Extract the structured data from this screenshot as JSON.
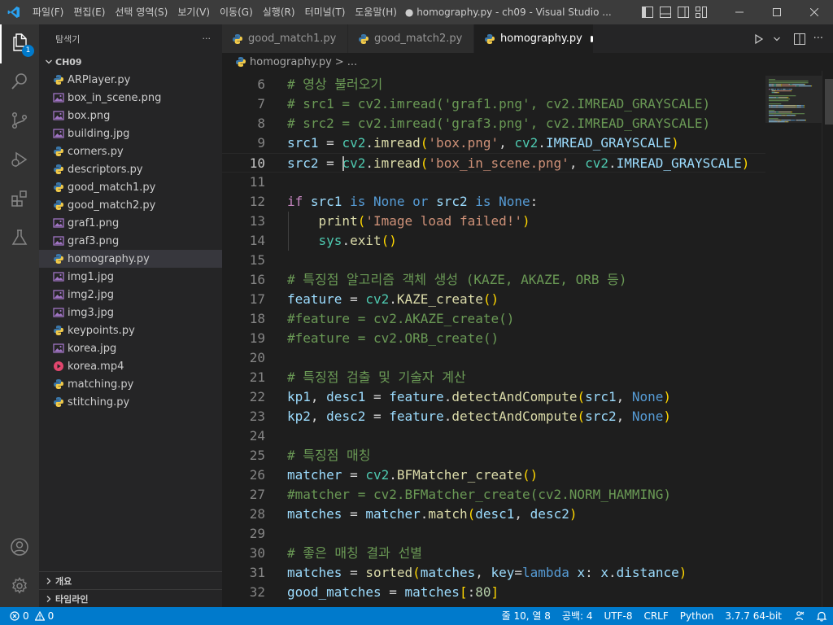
{
  "titlebar": {
    "menu": [
      "파일(F)",
      "편집(E)",
      "선택 영역(S)",
      "보기(V)",
      "이동(G)",
      "실행(R)",
      "터미널(T)",
      "도움말(H)"
    ],
    "title": "● homography.py - ch09 - Visual Studio ..."
  },
  "activitybar": {
    "items": [
      "files-icon",
      "search-icon",
      "source-control-icon",
      "run-debug-icon",
      "extensions-icon",
      "testing-icon"
    ],
    "explorer_badge": "1",
    "bottom": [
      "account-icon",
      "settings-gear-icon"
    ]
  },
  "sidebar": {
    "title": "탐색기",
    "more": "···",
    "folder": "CH09",
    "files": [
      {
        "name": "ARPlayer.py",
        "type": "python"
      },
      {
        "name": "box_in_scene.png",
        "type": "image"
      },
      {
        "name": "box.png",
        "type": "image"
      },
      {
        "name": "building.jpg",
        "type": "image"
      },
      {
        "name": "corners.py",
        "type": "python"
      },
      {
        "name": "descriptors.py",
        "type": "python"
      },
      {
        "name": "good_match1.py",
        "type": "python"
      },
      {
        "name": "good_match2.py",
        "type": "python"
      },
      {
        "name": "graf1.png",
        "type": "image"
      },
      {
        "name": "graf3.png",
        "type": "image"
      },
      {
        "name": "homography.py",
        "type": "python",
        "selected": true
      },
      {
        "name": "img1.jpg",
        "type": "image"
      },
      {
        "name": "img2.jpg",
        "type": "image"
      },
      {
        "name": "img3.jpg",
        "type": "image"
      },
      {
        "name": "keypoints.py",
        "type": "python"
      },
      {
        "name": "korea.jpg",
        "type": "image"
      },
      {
        "name": "korea.mp4",
        "type": "video"
      },
      {
        "name": "matching.py",
        "type": "python"
      },
      {
        "name": "stitching.py",
        "type": "python"
      }
    ],
    "outline": "개요",
    "timeline": "타임라인"
  },
  "tabs": [
    {
      "label": "good_match1.py",
      "active": false,
      "dirty": false
    },
    {
      "label": "good_match2.py",
      "active": false,
      "dirty": false
    },
    {
      "label": "homography.py",
      "active": true,
      "dirty": true
    }
  ],
  "breadcrumb": {
    "file": "homography.py",
    "sep": ">",
    "rest": "..."
  },
  "editor": {
    "current_line": 10,
    "lines": [
      {
        "n": 6,
        "tokens": [
          [
            "# 영상 불러오기",
            "cm"
          ]
        ]
      },
      {
        "n": 7,
        "tokens": [
          [
            "# src1 = cv2.imread('graf1.png', cv2.IMREAD_GRAYSCALE)",
            "cm"
          ]
        ]
      },
      {
        "n": 8,
        "tokens": [
          [
            "# src2 = cv2.imread('graf3.png', cv2.IMREAD_GRAYSCALE)",
            "cm"
          ]
        ]
      },
      {
        "n": 9,
        "tokens": [
          [
            "src1",
            "var"
          ],
          [
            " = ",
            "plain"
          ],
          [
            "cv2",
            "mod"
          ],
          [
            ".",
            "plain"
          ],
          [
            "imread",
            "fn"
          ],
          [
            "(",
            "p1"
          ],
          [
            "'box.png'",
            "str"
          ],
          [
            ", ",
            "plain"
          ],
          [
            "cv2",
            "mod"
          ],
          [
            ".",
            "plain"
          ],
          [
            "IMREAD_GRAYSCALE",
            "var"
          ],
          [
            ")",
            "p1"
          ]
        ]
      },
      {
        "n": 10,
        "tokens": [
          [
            "src2",
            "var"
          ],
          [
            " = ",
            "plain"
          ],
          [
            "cv2",
            "mod"
          ],
          [
            ".",
            "plain"
          ],
          [
            "imread",
            "fn"
          ],
          [
            "(",
            "p1"
          ],
          [
            "'box_in_scene.png'",
            "str"
          ],
          [
            ", ",
            "plain"
          ],
          [
            "cv2",
            "mod"
          ],
          [
            ".",
            "plain"
          ],
          [
            "IMREAD_GRAYSCALE",
            "var"
          ],
          [
            ")",
            "p1"
          ]
        ]
      },
      {
        "n": 11,
        "tokens": []
      },
      {
        "n": 12,
        "tokens": [
          [
            "if",
            "kw"
          ],
          [
            " ",
            "plain"
          ],
          [
            "src1",
            "var"
          ],
          [
            " ",
            "plain"
          ],
          [
            "is",
            "const"
          ],
          [
            " ",
            "plain"
          ],
          [
            "None",
            "const"
          ],
          [
            " ",
            "plain"
          ],
          [
            "or",
            "const"
          ],
          [
            " ",
            "plain"
          ],
          [
            "src2",
            "var"
          ],
          [
            " ",
            "plain"
          ],
          [
            "is",
            "const"
          ],
          [
            " ",
            "plain"
          ],
          [
            "None",
            "const"
          ],
          [
            ":",
            "plain"
          ]
        ]
      },
      {
        "n": 13,
        "tokens": [
          [
            "    ",
            "plain"
          ],
          [
            "print",
            "fn"
          ],
          [
            "(",
            "p1"
          ],
          [
            "'Image load failed!'",
            "str"
          ],
          [
            ")",
            "p1"
          ]
        ]
      },
      {
        "n": 14,
        "tokens": [
          [
            "    ",
            "plain"
          ],
          [
            "sys",
            "mod"
          ],
          [
            ".",
            "plain"
          ],
          [
            "exit",
            "fn"
          ],
          [
            "()",
            "p1"
          ]
        ]
      },
      {
        "n": 15,
        "tokens": []
      },
      {
        "n": 16,
        "tokens": [
          [
            "# 특징점 알고리즘 객체 생성 (KAZE, AKAZE, ORB 등)",
            "cm"
          ]
        ]
      },
      {
        "n": 17,
        "tokens": [
          [
            "feature",
            "var"
          ],
          [
            " = ",
            "plain"
          ],
          [
            "cv2",
            "mod"
          ],
          [
            ".",
            "plain"
          ],
          [
            "KAZE_create",
            "fn"
          ],
          [
            "()",
            "p1"
          ]
        ]
      },
      {
        "n": 18,
        "tokens": [
          [
            "#feature = cv2.AKAZE_create()",
            "cm"
          ]
        ]
      },
      {
        "n": 19,
        "tokens": [
          [
            "#feature = cv2.ORB_create()",
            "cm"
          ]
        ]
      },
      {
        "n": 20,
        "tokens": []
      },
      {
        "n": 21,
        "tokens": [
          [
            "# 특징점 검출 및 기술자 계산",
            "cm"
          ]
        ]
      },
      {
        "n": 22,
        "tokens": [
          [
            "kp1",
            "var"
          ],
          [
            ", ",
            "plain"
          ],
          [
            "desc1",
            "var"
          ],
          [
            " = ",
            "plain"
          ],
          [
            "feature",
            "var"
          ],
          [
            ".",
            "plain"
          ],
          [
            "detectAndCompute",
            "fn"
          ],
          [
            "(",
            "p1"
          ],
          [
            "src1",
            "var"
          ],
          [
            ", ",
            "plain"
          ],
          [
            "None",
            "const"
          ],
          [
            ")",
            "p1"
          ]
        ]
      },
      {
        "n": 23,
        "tokens": [
          [
            "kp2",
            "var"
          ],
          [
            ", ",
            "plain"
          ],
          [
            "desc2",
            "var"
          ],
          [
            " = ",
            "plain"
          ],
          [
            "feature",
            "var"
          ],
          [
            ".",
            "plain"
          ],
          [
            "detectAndCompute",
            "fn"
          ],
          [
            "(",
            "p1"
          ],
          [
            "src2",
            "var"
          ],
          [
            ", ",
            "plain"
          ],
          [
            "None",
            "const"
          ],
          [
            ")",
            "p1"
          ]
        ]
      },
      {
        "n": 24,
        "tokens": []
      },
      {
        "n": 25,
        "tokens": [
          [
            "# 특징점 매칭",
            "cm"
          ]
        ]
      },
      {
        "n": 26,
        "tokens": [
          [
            "matcher",
            "var"
          ],
          [
            " = ",
            "plain"
          ],
          [
            "cv2",
            "mod"
          ],
          [
            ".",
            "plain"
          ],
          [
            "BFMatcher_create",
            "fn"
          ],
          [
            "()",
            "p1"
          ]
        ]
      },
      {
        "n": 27,
        "tokens": [
          [
            "#matcher = cv2.BFMatcher_create(cv2.NORM_HAMMING)",
            "cm"
          ]
        ]
      },
      {
        "n": 28,
        "tokens": [
          [
            "matches",
            "var"
          ],
          [
            " = ",
            "plain"
          ],
          [
            "matcher",
            "var"
          ],
          [
            ".",
            "plain"
          ],
          [
            "match",
            "fn"
          ],
          [
            "(",
            "p1"
          ],
          [
            "desc1",
            "var"
          ],
          [
            ", ",
            "plain"
          ],
          [
            "desc2",
            "var"
          ],
          [
            ")",
            "p1"
          ]
        ]
      },
      {
        "n": 29,
        "tokens": []
      },
      {
        "n": 30,
        "tokens": [
          [
            "# 좋은 매칭 결과 선별",
            "cm"
          ]
        ]
      },
      {
        "n": 31,
        "tokens": [
          [
            "matches",
            "var"
          ],
          [
            " = ",
            "plain"
          ],
          [
            "sorted",
            "fn"
          ],
          [
            "(",
            "p1"
          ],
          [
            "matches",
            "var"
          ],
          [
            ", ",
            "plain"
          ],
          [
            "key",
            "var"
          ],
          [
            "=",
            "plain"
          ],
          [
            "lambda",
            "const"
          ],
          [
            " ",
            "plain"
          ],
          [
            "x",
            "var"
          ],
          [
            ": ",
            "plain"
          ],
          [
            "x",
            "var"
          ],
          [
            ".",
            "plain"
          ],
          [
            "distance",
            "var"
          ],
          [
            ")",
            "p1"
          ]
        ]
      },
      {
        "n": 32,
        "tokens": [
          [
            "good_matches",
            "var"
          ],
          [
            " = ",
            "plain"
          ],
          [
            "matches",
            "var"
          ],
          [
            "[",
            "p1"
          ],
          [
            ":",
            "plain"
          ],
          [
            "80",
            "num"
          ],
          [
            "]",
            "p1"
          ]
        ]
      }
    ]
  },
  "statusbar": {
    "errors": "0",
    "warnings": "0",
    "position": "줄 10, 열 8",
    "spaces": "공백: 4",
    "encoding": "UTF-8",
    "eol": "CRLF",
    "language": "Python",
    "interpreter": "3.7.7 64-bit"
  },
  "colors": {
    "accent": "#007acc",
    "activitybar": "#333333",
    "sidebar": "#252526",
    "editor": "#1e1e1e",
    "titlebar": "#3c3c3c"
  }
}
